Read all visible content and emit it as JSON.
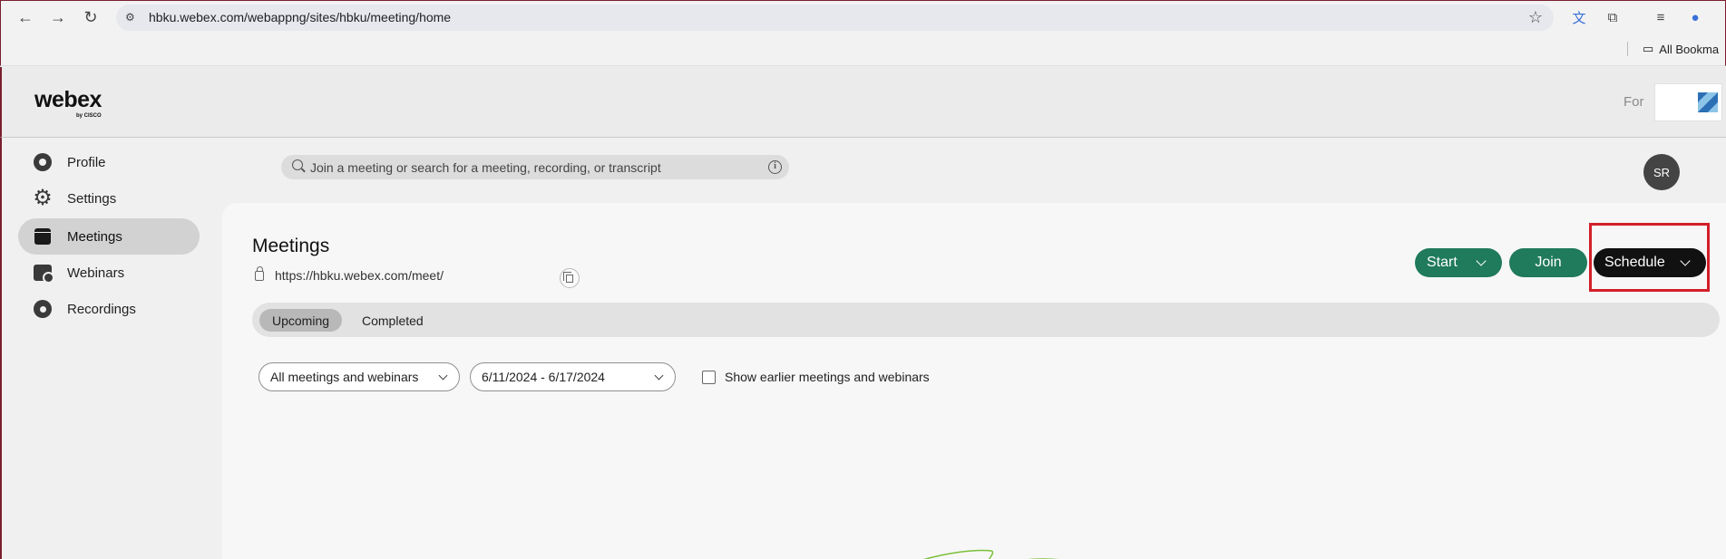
{
  "browser": {
    "url": "hbku.webex.com/webappng/sites/hbku/meeting/home",
    "bookmarks_label": "All Bookma"
  },
  "header": {
    "logo_text": "webex",
    "logo_sub": "by CISCO",
    "for_label": "For"
  },
  "sidebar": {
    "items": [
      {
        "label": "Profile",
        "icon": "profile-icon"
      },
      {
        "label": "Settings",
        "icon": "gear-icon"
      },
      {
        "label": "Meetings",
        "icon": "calendar-icon",
        "active": true
      },
      {
        "label": "Webinars",
        "icon": "webinar-icon"
      },
      {
        "label": "Recordings",
        "icon": "recording-icon"
      }
    ]
  },
  "search": {
    "placeholder": "Join a meeting or search for a meeting, recording, or transcript"
  },
  "user": {
    "initials": "SR"
  },
  "main": {
    "title": "Meetings",
    "meeting_link": "https://hbku.webex.com/meet/",
    "buttons": {
      "start": "Start",
      "join": "Join",
      "schedule": "Schedule"
    },
    "tabs": [
      {
        "label": "Upcoming",
        "active": true
      },
      {
        "label": "Completed",
        "active": false
      }
    ],
    "filters": {
      "type_filter": "All meetings and webinars",
      "date_range": "6/11/2024 - 6/17/2024",
      "show_earlier_label": "Show earlier meetings and webinars",
      "show_earlier_checked": false
    }
  },
  "colors": {
    "accent_green": "#207a5c",
    "schedule_black": "#111111",
    "highlight_red": "#d21f2a"
  }
}
